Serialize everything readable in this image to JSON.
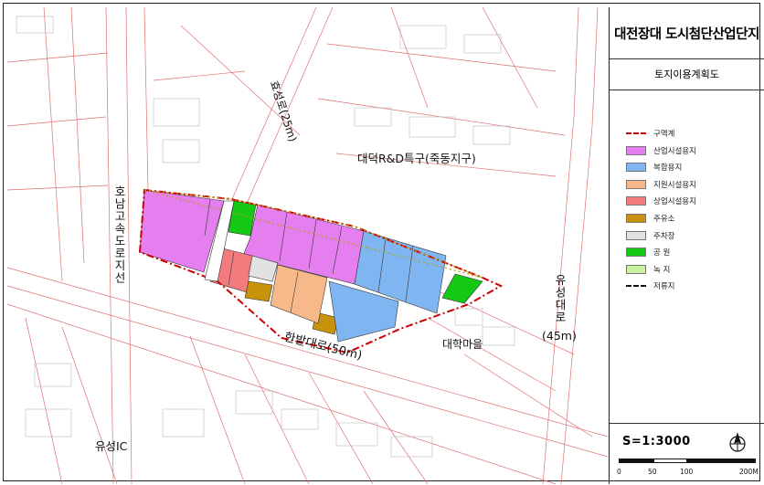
{
  "map": {
    "labels": {
      "road_north": "효성로(25m)",
      "district": "대덕R&D특구(죽동지구)",
      "expressway": "호남고속도로지선",
      "road_east": "유성대로",
      "road_east_width": "(45m)",
      "road_south": "한밭대로(50m)",
      "village": "대학마을",
      "ic": "유성IC"
    },
    "colors": {
      "industrial": "#e57ff0",
      "complex": "#7fb6f2",
      "support": "#f7b98a",
      "commercial": "#f37b7d",
      "gas_station": "#c9920b",
      "parking": "#e2e2e2",
      "park": "#16c816",
      "green": "#c6f2a0",
      "boundary": "#cc0000",
      "road_line": "#e07070"
    }
  },
  "panel": {
    "title": "대전장대 도시첨단산업단지",
    "subtitle": "토지이용계획도",
    "legend": [
      {
        "label": "구역계",
        "kind": "boundary-line",
        "color": "#cc0000",
        "icon": "dashed-line"
      },
      {
        "label": "산업시설용지",
        "kind": "fill",
        "color": "#e57ff0"
      },
      {
        "label": "복합용지",
        "kind": "fill",
        "color": "#7fb6f2"
      },
      {
        "label": "지원시설용지",
        "kind": "fill",
        "color": "#f7b98a"
      },
      {
        "label": "상업시설용지",
        "kind": "fill",
        "color": "#f37b7d"
      },
      {
        "label": "주유소",
        "kind": "fill",
        "color": "#c9920b"
      },
      {
        "label": "주차장",
        "kind": "fill",
        "color": "#e2e2e2"
      },
      {
        "label": "공   원",
        "kind": "fill",
        "color": "#16c816"
      },
      {
        "label": "녹   지",
        "kind": "fill",
        "color": "#c6f2a0"
      },
      {
        "label": "저류지",
        "kind": "detention-line",
        "color": "#111111",
        "icon": "dashed-line"
      }
    ],
    "scale": {
      "text": "S=1:3000",
      "ticks": [
        "0",
        "50",
        "100",
        "200M"
      ],
      "north_icon": "north-arrow-icon"
    }
  }
}
